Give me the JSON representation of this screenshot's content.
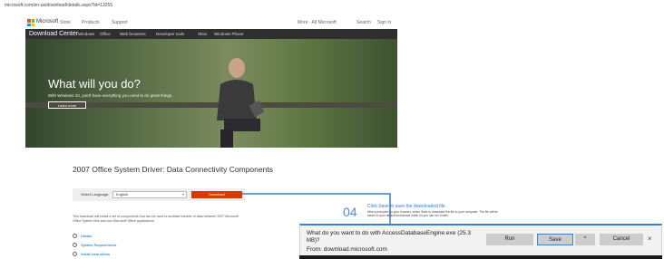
{
  "url_bar": {
    "text": "microsoft.com/en-us/download/details.aspx?id=13255"
  },
  "ms_header": {
    "brand": "Microsoft",
    "nav": [
      "Store",
      "Products",
      "Support"
    ],
    "right": [
      "More · All Microsoft",
      "Search",
      "Sign in"
    ]
  },
  "download_nav": {
    "title": "Download Center",
    "items": [
      "Windows",
      "Office",
      "Web browsers",
      "Developer tools",
      "Xbox",
      "Windows Phone"
    ]
  },
  "hero": {
    "title": "What will you do?",
    "subtitle": "With Windows 10, you'll have everything you need to do great things.",
    "button": "Learn more"
  },
  "page": {
    "heading": "2007 Office System Driver: Data Connectivity Components",
    "language_label": "Select Language:",
    "language_value": "English",
    "download_button": "Download",
    "description": "This download will install a set of components that can be used to facilitate transfer of data between 2007 Microsoft Office System files and non-Microsoft Office applications.",
    "links": [
      "Details",
      "System Requirements",
      "Install Instructions"
    ]
  },
  "step": {
    "number": "04",
    "title": "Click Save to save the downloaded file.",
    "description": "When prompted by your browser, select Save to download the file to your computer. The file will be saved to your default downloads folder so you can run it later."
  },
  "download_bar": {
    "question": "What do you want to do with AccessDatabaseEngine.exe (25.3",
    "size": "MB)?",
    "from": "From: download.microsoft.com",
    "run": "Run",
    "save": "Save",
    "save_menu": "^",
    "cancel": "Cancel",
    "close": "×"
  },
  "colors": {
    "accent": "#d83b01",
    "annotation": "#3c82c9",
    "dark_nav": "#2f2f2f"
  }
}
